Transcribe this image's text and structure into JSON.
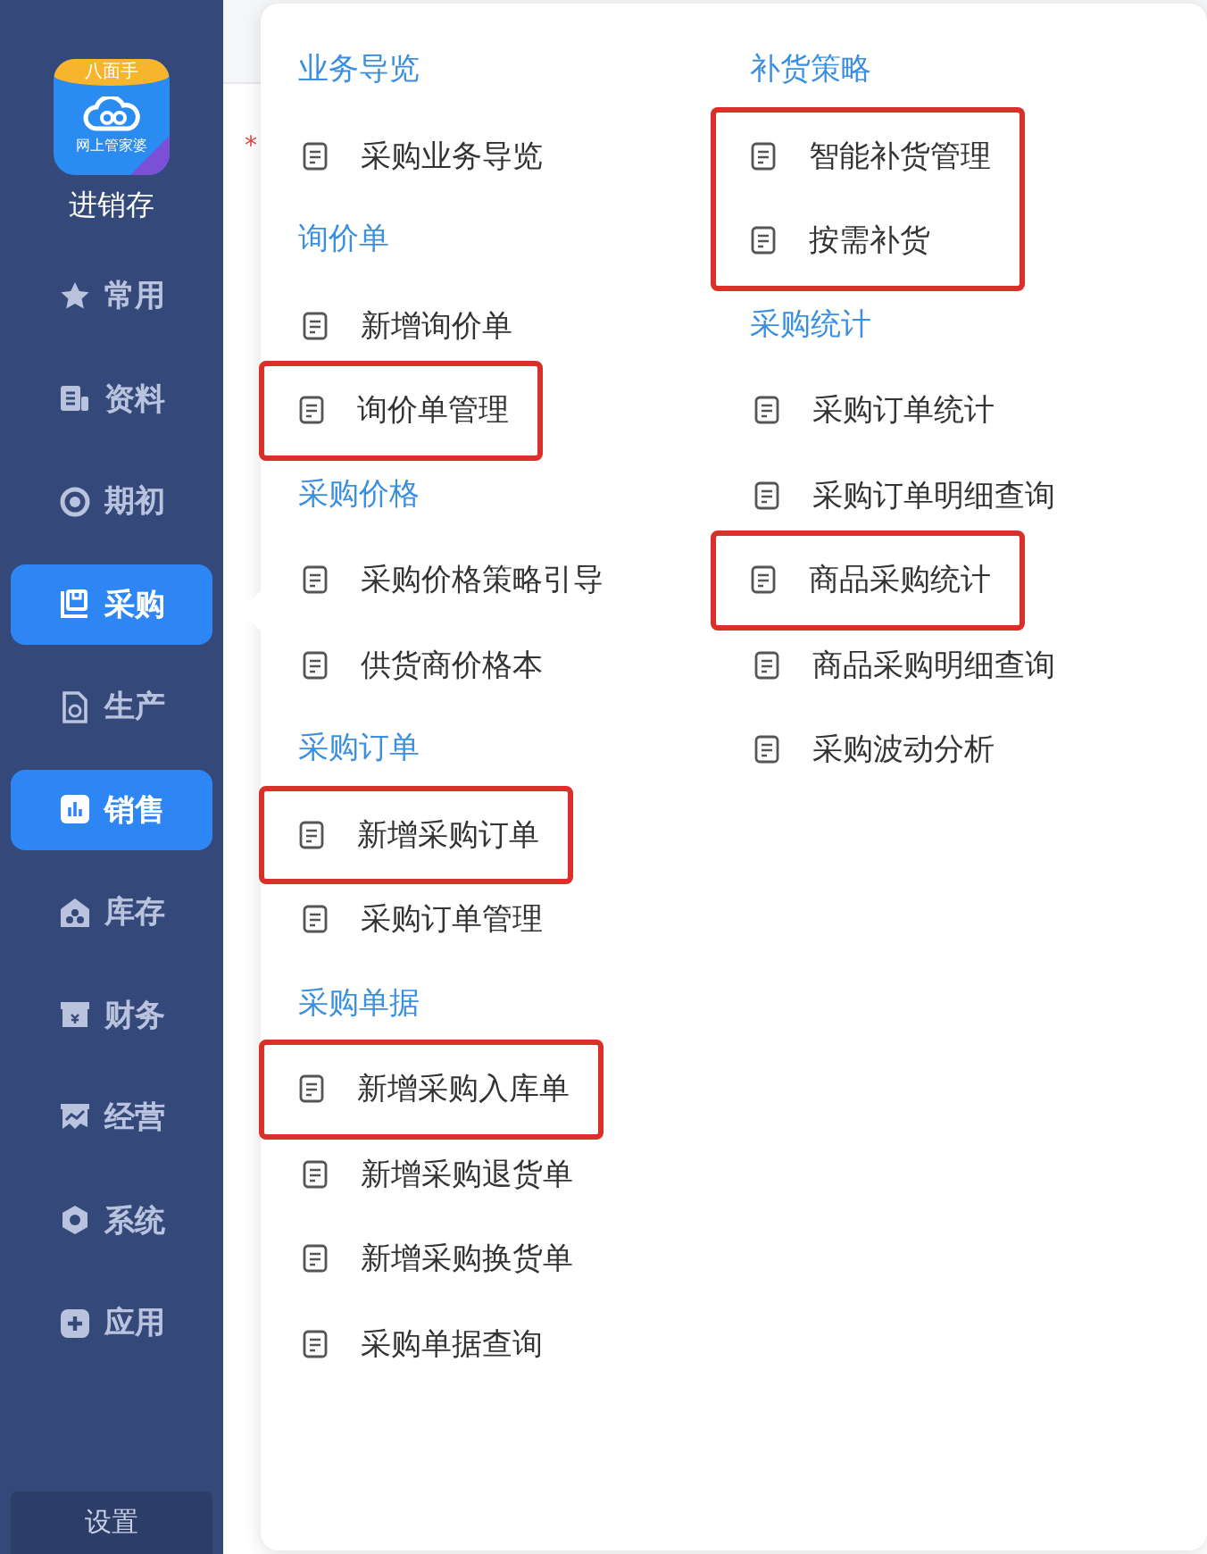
{
  "sidebar": {
    "logo": {
      "banner": "八面手",
      "caption": "网上管家婆",
      "title": "进销存"
    },
    "items": [
      {
        "label": "常用",
        "selected": false
      },
      {
        "label": "资料",
        "selected": false
      },
      {
        "label": "期初",
        "selected": false
      },
      {
        "label": "采购",
        "selected": true
      },
      {
        "label": "生产",
        "selected": false
      },
      {
        "label": "销售",
        "selected": true
      },
      {
        "label": "库存",
        "selected": false
      },
      {
        "label": "财务",
        "selected": false
      },
      {
        "label": "经营",
        "selected": false
      },
      {
        "label": "系统",
        "selected": false
      },
      {
        "label": "应用",
        "selected": false
      }
    ],
    "settings": "设置"
  },
  "background": {
    "required_mark": "*"
  },
  "menu": {
    "columns": [
      [
        {
          "heading": "业务导览",
          "items": [
            {
              "label": "采购业务导览",
              "highlighted": false
            }
          ]
        },
        {
          "heading": "询价单",
          "items": [
            {
              "label": "新增询价单",
              "highlighted": false
            },
            {
              "label": "询价单管理",
              "highlighted": true
            }
          ]
        },
        {
          "heading": "采购价格",
          "items": [
            {
              "label": "采购价格策略引导",
              "highlighted": false
            },
            {
              "label": "供货商价格本",
              "highlighted": false
            }
          ]
        },
        {
          "heading": "采购订单",
          "items": [
            {
              "label": "新增采购订单",
              "highlighted": true
            },
            {
              "label": "采购订单管理",
              "highlighted": false
            }
          ]
        },
        {
          "heading": "采购单据",
          "items": [
            {
              "label": "新增采购入库单",
              "highlighted": true
            },
            {
              "label": "新增采购退货单",
              "highlighted": false
            },
            {
              "label": "新增采购换货单",
              "highlighted": false
            },
            {
              "label": "采购单据查询",
              "highlighted": false
            }
          ]
        }
      ],
      [
        {
          "heading": "补货策略",
          "items": [
            {
              "label": "智能补货管理",
              "highlighted": true
            },
            {
              "label": "按需补货",
              "highlighted": true
            }
          ]
        },
        {
          "heading": "采购统计",
          "items": [
            {
              "label": "采购订单统计",
              "highlighted": false
            },
            {
              "label": "采购订单明细查询",
              "highlighted": false
            },
            {
              "label": "商品采购统计",
              "highlighted": true
            },
            {
              "label": "商品采购明细查询",
              "highlighted": false
            },
            {
              "label": "采购波动分析",
              "highlighted": false
            }
          ]
        }
      ]
    ]
  }
}
